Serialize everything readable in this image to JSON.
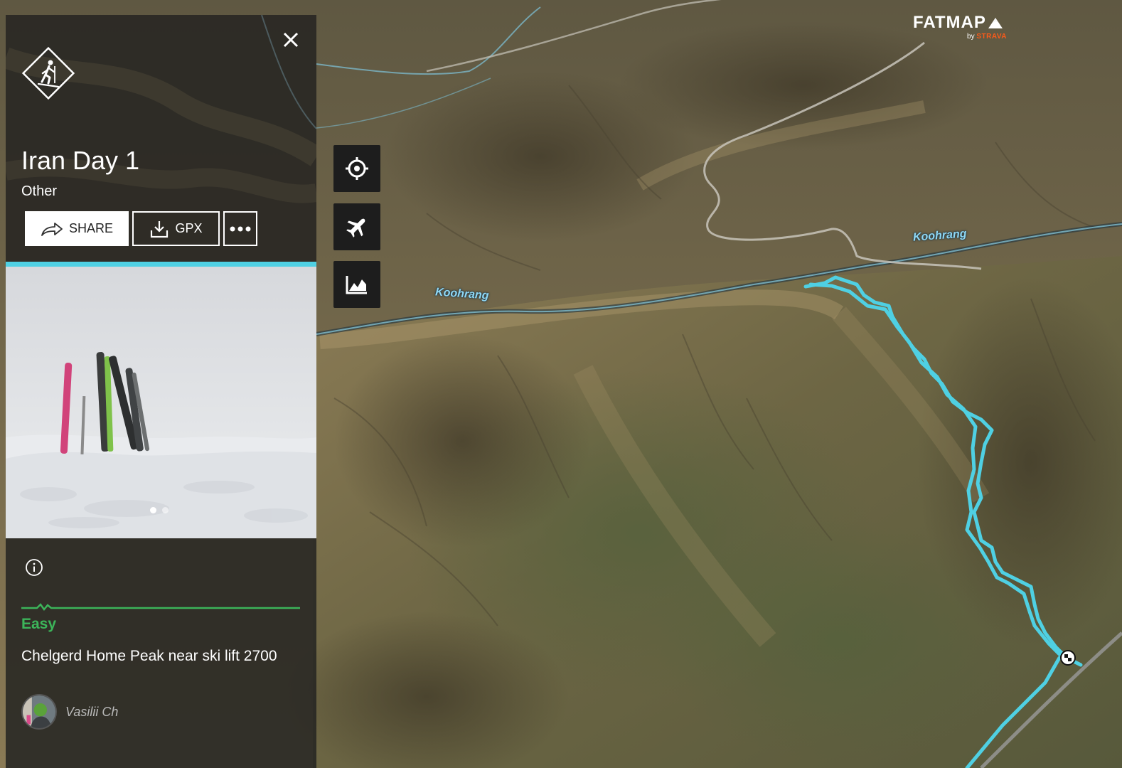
{
  "brand": {
    "name": "FATMAP",
    "by": "by",
    "partner": "STRAVA",
    "partner_color": "#fc5a1a"
  },
  "map": {
    "river_labels": [
      "Koohrang",
      "Koohrang"
    ],
    "route_color": "#4fd0e3",
    "controls": [
      {
        "name": "locate",
        "icon": "crosshair-icon"
      },
      {
        "name": "fly",
        "icon": "airplane-icon"
      },
      {
        "name": "elevation",
        "icon": "elevation-chart-icon"
      }
    ]
  },
  "panel": {
    "activity_icon": "ski-touring-icon",
    "title": "Iran Day 1",
    "type": "Other",
    "buttons": {
      "share": "SHARE",
      "gpx": "GPX",
      "more": "•••"
    },
    "accent_color": "#4fd0e3",
    "photo": {
      "page_count": 2,
      "active_index": 0
    },
    "difficulty": {
      "label": "Easy",
      "color": "#3cb55a"
    },
    "description": "Chelgerd Home Peak near ski lift 2700",
    "author": {
      "name": "Vasilii Ch"
    }
  }
}
